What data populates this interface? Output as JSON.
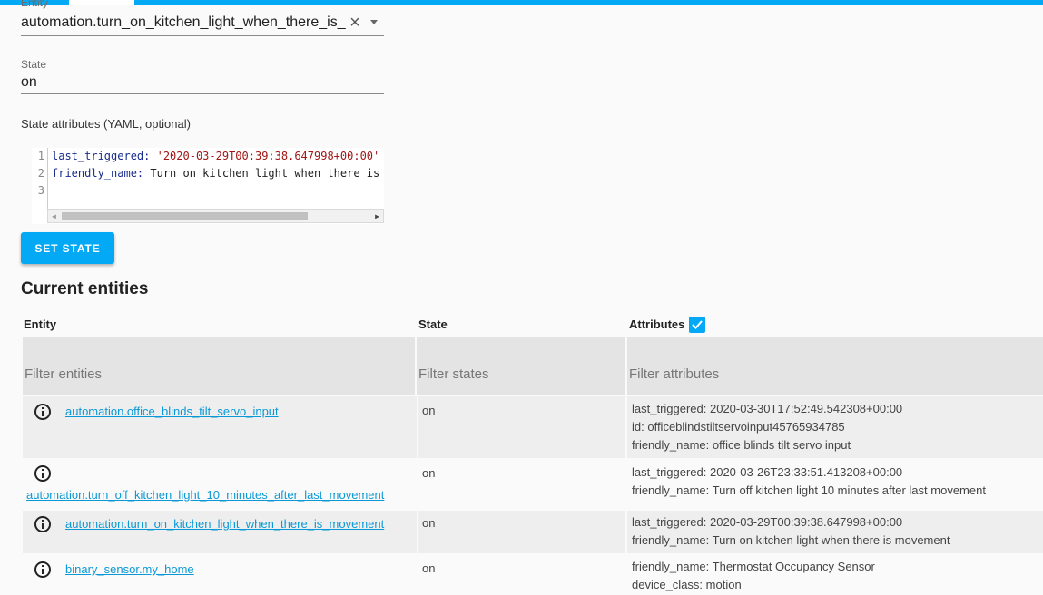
{
  "entity_field": {
    "label": "Entity",
    "value": "automation.turn_on_kitchen_light_when_there_is_movement"
  },
  "state_field": {
    "label": "State",
    "value": "on"
  },
  "attributes_label": "State attributes (YAML, optional)",
  "editor": {
    "line_numbers": [
      "1",
      "2",
      "3"
    ],
    "line1_key": "last_triggered:",
    "line1_value": " '2020-03-29T00:39:38.647998+00:00'",
    "line2_key": "friendly_name:",
    "line2_value": " Turn on kitchen light when there is movement"
  },
  "set_state_button": "SET STATE",
  "section_title": "Current entities",
  "table": {
    "headers": {
      "entity": "Entity",
      "state": "State",
      "attributes": "Attributes"
    },
    "attributes_checked": true,
    "filters": {
      "entities": "Filter entities",
      "states": "Filter states",
      "attributes": "Filter attributes"
    },
    "rows": [
      {
        "entity": "automation.office_blinds_tilt_servo_input",
        "state": "on",
        "attributes": [
          "last_triggered: 2020-03-30T17:52:49.542308+00:00",
          "id: officeblindstiltservoinput45765934785",
          "friendly_name: office blinds tilt servo input"
        ]
      },
      {
        "entity": "automation.turn_off_kitchen_light_10_minutes_after_last_movement",
        "state": "on",
        "attributes": [
          "last_triggered: 2020-03-26T23:33:51.413208+00:00",
          "friendly_name: Turn off kitchen light 10 minutes after last movement"
        ]
      },
      {
        "entity": "automation.turn_on_kitchen_light_when_there_is_movement",
        "state": "on",
        "attributes": [
          "last_triggered: 2020-03-29T00:39:38.647998+00:00",
          "friendly_name: Turn on kitchen light when there is movement"
        ]
      },
      {
        "entity": "binary_sensor.my_home",
        "state": "on",
        "attributes": [
          "friendly_name: Thermostat Occupancy Sensor",
          "device_class: motion"
        ]
      }
    ]
  },
  "colors": {
    "accent": "#03a9f4",
    "link": "#0a99d6"
  }
}
